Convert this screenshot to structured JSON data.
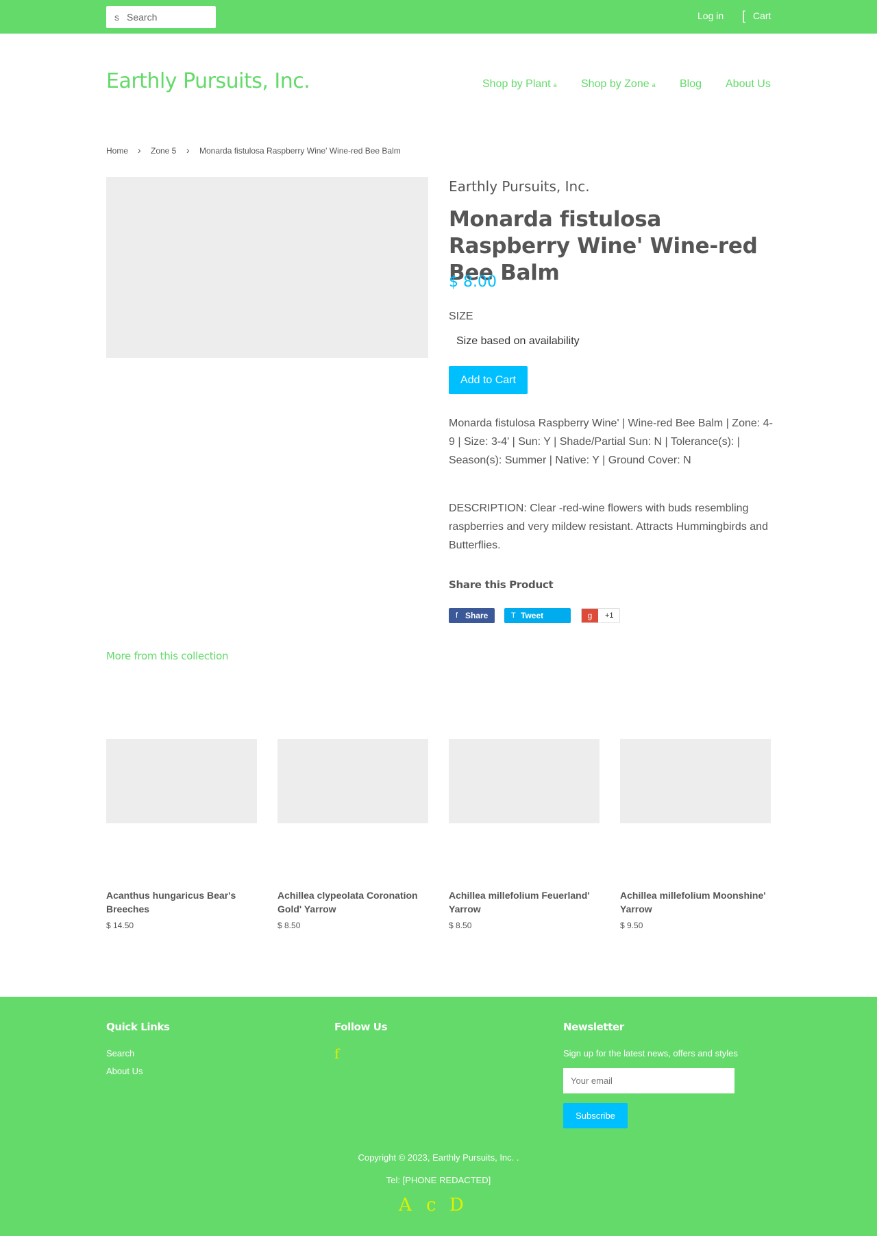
{
  "header": {
    "search_icon": "s",
    "search_placeholder": "Search",
    "login": "Log in",
    "cart_icon": "[",
    "cart": "Cart"
  },
  "site": {
    "logo": "Earthly Pursuits, Inc."
  },
  "nav": {
    "caret": "a",
    "items": [
      {
        "label": "Shop by Plant"
      },
      {
        "label": "Shop by Zone"
      },
      {
        "label": "Blog"
      },
      {
        "label": "About Us"
      }
    ]
  },
  "breadcrumb": {
    "separator": "›",
    "items": [
      "Home",
      "Zone 5",
      "Monarda fistulosa Raspberry Wine' Wine-red Bee Balm"
    ]
  },
  "product": {
    "vendor": "Earthly Pursuits, Inc.",
    "title": "Monarda fistulosa Raspberry Wine' Wine-red Bee Balm",
    "price": "$ 8.00",
    "size_label": "SIZE",
    "size_value": "Size based on availability",
    "add_to_cart": "Add to Cart",
    "summary": "Monarda fistulosa Raspberry Wine' | Wine-red Bee Balm | Zone: 4-9 | Size: 3-4' | Sun: Y | Shade/Partial Sun: N | Tolerance(s): | Season(s): Summer | Native: Y | Ground Cover: N",
    "description": "DESCRIPTION: Clear -red-wine flowers with buds resembling raspberries and very mildew resistant. Attracts Hummingbirds and Butterflies."
  },
  "share": {
    "heading": "Share this Product",
    "facebook": {
      "glyph": "f",
      "label": "Share"
    },
    "twitter": {
      "glyph": "T",
      "label": "Tweet"
    },
    "google": {
      "glyph": "g",
      "count": "+1"
    }
  },
  "collection": {
    "heading": "More from this collection",
    "items": [
      {
        "name": "Acanthus hungaricus Bear's Breeches",
        "price": "$ 14.50"
      },
      {
        "name": "Achillea clypeolata Coronation Gold' Yarrow",
        "price": "$ 8.50"
      },
      {
        "name": "Achillea millefolium Feuerland' Yarrow",
        "price": "$ 8.50"
      },
      {
        "name": "Achillea millefolium Moonshine' Yarrow",
        "price": "$ 9.50"
      }
    ]
  },
  "footer": {
    "quick_links_heading": "Quick Links",
    "quick_links": [
      "Search",
      "About Us"
    ],
    "follow_heading": "Follow Us",
    "follow_icon": "f",
    "newsletter_heading": "Newsletter",
    "newsletter_text": "Sign up for the latest news, offers and styles",
    "email_placeholder": "Your email",
    "subscribe": "Subscribe",
    "copyright": "Copyright © 2023, Earthly Pursuits, Inc. .",
    "tel": "Tel: [PHONE REDACTED]",
    "payment_icons": [
      "A",
      "c",
      "D"
    ]
  },
  "colors": {
    "brand_green": "#64da6a",
    "accent_blue": "#00bfff",
    "placeholder_gray": "#ededed",
    "footer_icon_yellow": "#dff000"
  }
}
